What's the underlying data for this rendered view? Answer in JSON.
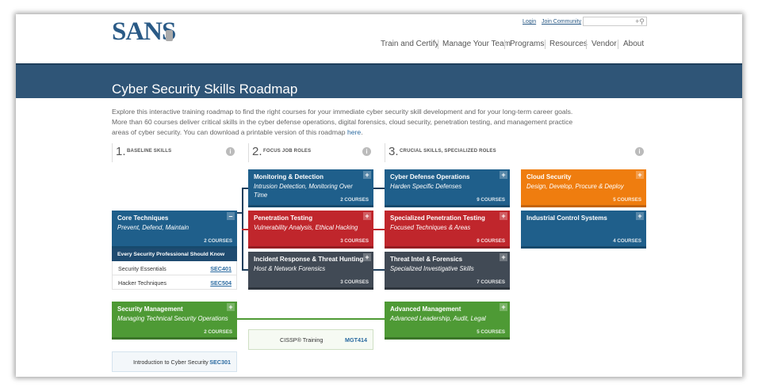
{
  "header": {
    "logo": "SANS",
    "login": "Login",
    "join": "Join Community",
    "search_placeholder": "",
    "nav": [
      "Train and Certify",
      "Manage Your Team",
      "Programs",
      "Resources",
      "Vendor",
      "About"
    ]
  },
  "banner": {
    "title": "Cyber Security Skills Roadmap"
  },
  "intro": {
    "text": "Explore this interactive training roadmap to find the right courses for your immediate cyber security skill development and for your long-term career goals. More than 60 courses deliver critical skills in the cyber defense operations, digital forensics, cloud security, penetration testing, and management practice areas of cyber security. You can download a printable version of this roadmap ",
    "link": "here",
    "end": "."
  },
  "columns": [
    {
      "num": "1.",
      "label": "BASELINE SKILLS"
    },
    {
      "num": "2.",
      "label": "FOCUS JOB ROLES"
    },
    {
      "num": "3.",
      "label": "CRUCIAL SKILLS, SPECIALIZED ROLES"
    }
  ],
  "info_glyph": "i",
  "cards": {
    "core": {
      "title": "Core Techniques",
      "sub": "Prevent, Defend, Maintain",
      "courses": "2 COURSES",
      "toggle": "–"
    },
    "monitoring": {
      "title": "Monitoring & Detection",
      "sub": "Intrusion Detection, Monitoring Over Time",
      "courses": "2 COURSES",
      "toggle": "+"
    },
    "pentest": {
      "title": "Penetration Testing",
      "sub": "Vulnerability Analysis, Ethical Hacking",
      "courses": "3 COURSES",
      "toggle": "+"
    },
    "incident": {
      "title": "Incident Response & Threat Hunting",
      "sub": "Host & Network Forensics",
      "courses": "3 COURSES",
      "toggle": "+"
    },
    "cyberdef": {
      "title": "Cyber Defense Operations",
      "sub": "Harden Specific Defenses",
      "courses": "9 COURSES",
      "toggle": "+"
    },
    "specpen": {
      "title": "Specialized Penetration Testing",
      "sub": "Focused Techniques & Areas",
      "courses": "9 COURSES",
      "toggle": "+"
    },
    "threatintel": {
      "title": "Threat Intel & Forensics",
      "sub": "Specialized Investigative Skills",
      "courses": "7 COURSES",
      "toggle": "+"
    },
    "cloud": {
      "title": "Cloud Security",
      "sub": "Design, Develop, Procure & Deploy",
      "courses": "5 COURSES",
      "toggle": "+"
    },
    "ics": {
      "title": "Industrial Control Systems",
      "sub": "",
      "courses": "4 COURSES",
      "toggle": "+"
    },
    "secmgmt": {
      "title": "Security Management",
      "sub": "Managing Technical Security Operations",
      "courses": "2 COURSES",
      "toggle": "+"
    },
    "advmgmt": {
      "title": "Advanced Management",
      "sub": "Advanced Leadership, Audit, Legal",
      "courses": "5 COURSES",
      "toggle": "+"
    }
  },
  "core_sub": {
    "head": "Every Security Professional Should Know",
    "rows": [
      {
        "name": "Security Essentials",
        "code": "SEC401"
      },
      {
        "name": "Hacker Techniques",
        "code": "SEC504"
      }
    ]
  },
  "plain": {
    "cissp": {
      "name": "CISSP® Training",
      "code": "MGT414"
    },
    "intro_course": {
      "name": "Introduction to Cyber Security",
      "code": "SEC301"
    }
  },
  "colors": {
    "blue": "#1f5f8b",
    "red": "#c0262c",
    "dark": "#414a55",
    "green": "#4e9a35",
    "orange": "#ef7d0f",
    "banner": "#2f5577"
  }
}
